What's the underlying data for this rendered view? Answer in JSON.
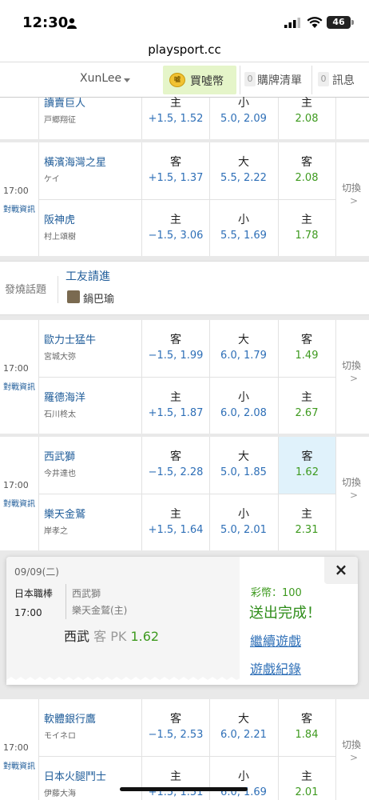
{
  "status": {
    "time": "12:30",
    "battery": "46"
  },
  "url": "playsport.cc",
  "nav": {
    "user": "XunLee",
    "buy": "買噓幣",
    "coin_badge": "噓",
    "cart_count": "0",
    "cart": "購牌清單",
    "msg_count": "0",
    "msg": "訊息"
  },
  "games": [
    {
      "rows": [
        {
          "team": "讀賣巨人",
          "pitcher": "戸郷翔征",
          "spread_side": "主",
          "spread": "+1.5, 1.52",
          "total_side": "小",
          "total": "5.0, 2.09",
          "ml_side": "主",
          "ml": "2.08"
        }
      ]
    },
    {
      "time": "17:00",
      "vs": "對戰資訊",
      "switch": "切換",
      "rows": [
        {
          "team": "橫濱海灣之星",
          "pitcher": "ケイ",
          "spread_side": "客",
          "spread": "+1.5, 1.37",
          "total_side": "大",
          "total": "5.5, 2.22",
          "ml_side": "客",
          "ml": "2.08"
        },
        {
          "team": "阪神虎",
          "pitcher": "村上頌樹",
          "spread_side": "主",
          "spread": "−1.5, 3.06",
          "total_side": "小",
          "total": "5.5, 1.69",
          "ml_side": "主",
          "ml": "1.78"
        }
      ]
    },
    {
      "time": "17:00",
      "vs": "對戰資訊",
      "switch": "切換",
      "rows": [
        {
          "team": "歐力士猛牛",
          "pitcher": "宮城大弥",
          "spread_side": "客",
          "spread": "−1.5, 1.99",
          "total_side": "大",
          "total": "6.0, 1.79",
          "ml_side": "客",
          "ml": "1.49"
        },
        {
          "team": "羅德海洋",
          "pitcher": "石川柊太",
          "spread_side": "主",
          "spread": "+1.5, 1.87",
          "total_side": "小",
          "total": "6.0, 2.08",
          "ml_side": "主",
          "ml": "2.67"
        }
      ]
    },
    {
      "time": "17:00",
      "vs": "對戰資訊",
      "switch": "切換",
      "rows": [
        {
          "team": "西武獅",
          "pitcher": "今井達也",
          "spread_side": "客",
          "spread": "−1.5, 2.28",
          "total_side": "大",
          "total": "5.0, 1.85",
          "ml_side": "客",
          "ml": "1.62"
        },
        {
          "team": "樂天金鷲",
          "pitcher": "岸孝之",
          "spread_side": "主",
          "spread": "+1.5, 1.64",
          "total_side": "小",
          "total": "5.0, 2.01",
          "ml_side": "主",
          "ml": "2.31"
        }
      ]
    },
    {
      "time": "17:00",
      "vs": "對戰資訊",
      "switch": "切換",
      "rows": [
        {
          "team": "軟體銀行鷹",
          "pitcher": "モイネロ",
          "spread_side": "客",
          "spread": "−1.5, 2.53",
          "total_side": "大",
          "total": "6.0, 2.21",
          "ml_side": "客",
          "ml": "1.84"
        },
        {
          "team": "日本火腿鬥士",
          "pitcher": "伊藤大海",
          "spread_side": "主",
          "spread": "+1.5, 1.51",
          "total_side": "小",
          "total": "6.0, 1.69",
          "ml_side": "主",
          "ml": "2.01"
        }
      ]
    }
  ],
  "forum": {
    "label": "發燒話題",
    "title": "工友請進",
    "author": "鍋巴瑜"
  },
  "ticket": {
    "date": "09/09(二)",
    "league": "日本職棒",
    "time": "17:00",
    "team1": "西武獅",
    "team2": "樂天金鷲(主)",
    "pick_team": "西武",
    "pick_side": "客",
    "pick_line": "PK",
    "pick_odds": "1.62",
    "coins": "彩幣：100",
    "done": "送出完成！",
    "continue": "繼續遊戲",
    "history": "遊戲紀錄",
    "close": "×"
  },
  "colors": {
    "team_blue": "#1f5c99",
    "odds_blue": "#2e6fb7",
    "odds_green": "#3e9a1f",
    "selected_bg": "#e0f2fb",
    "buy_bg": "#e5f5c9"
  }
}
